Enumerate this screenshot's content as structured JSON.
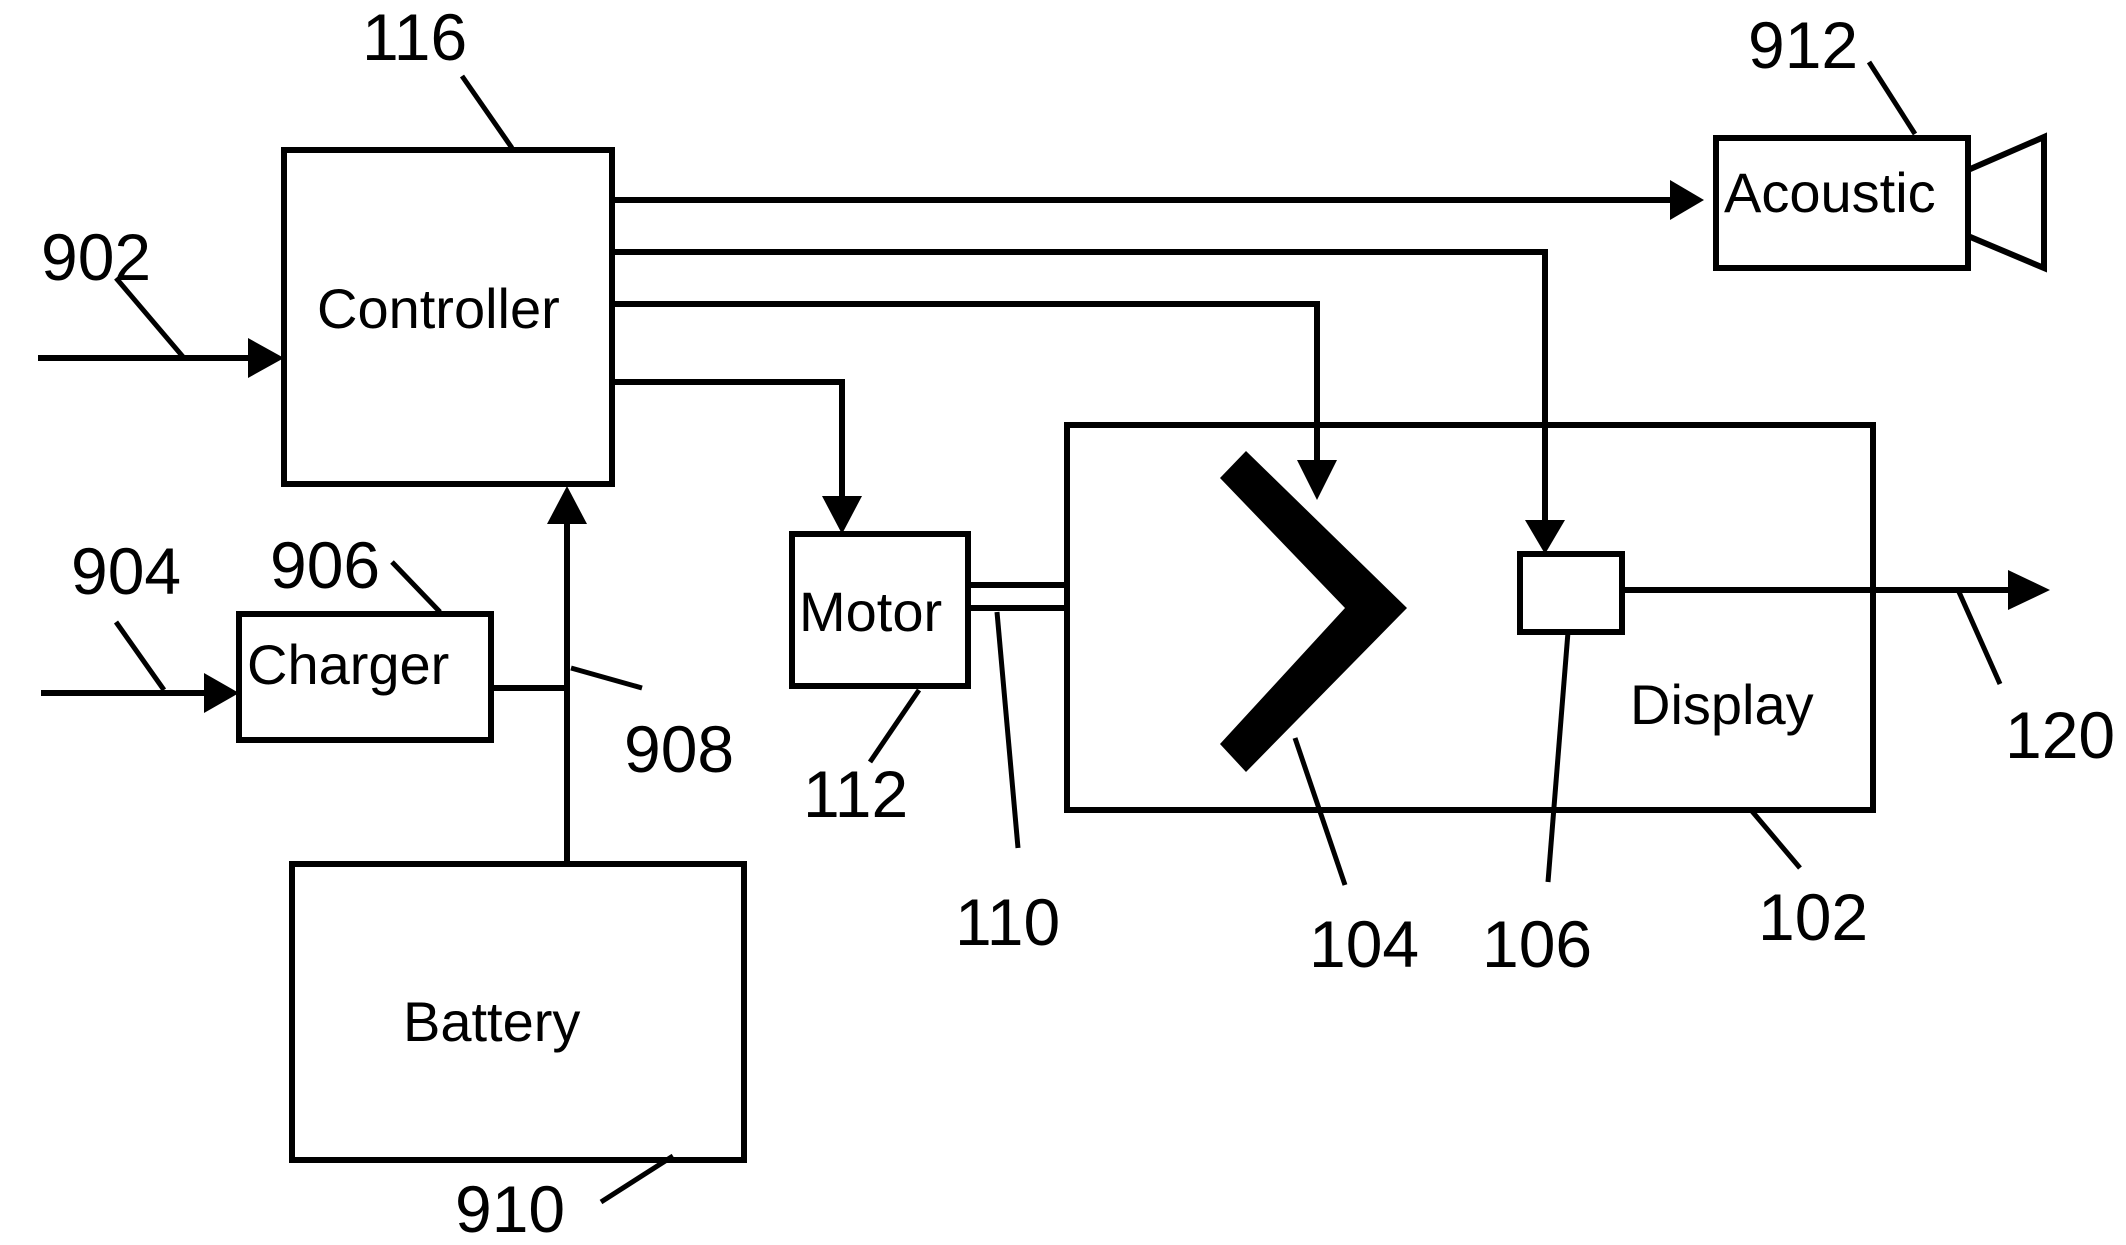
{
  "diagram": {
    "type": "block-diagram",
    "blocks": {
      "controller": {
        "label": "Controller",
        "ref": "116"
      },
      "charger": {
        "label": "Charger",
        "ref": "906"
      },
      "battery": {
        "label": "Battery",
        "ref": "910"
      },
      "motor": {
        "label": "Motor",
        "ref": "112"
      },
      "display": {
        "label": "Display",
        "ref": "102"
      },
      "acoustic": {
        "label": "Acoustic",
        "ref": "912"
      },
      "sensor": {
        "label": "",
        "ref": "106"
      },
      "reflector": {
        "label": "",
        "ref": "104"
      }
    },
    "refs": {
      "input_controller": "902",
      "input_charger": "904",
      "power_line": "908",
      "shaft": "110",
      "output": "120"
    },
    "connections": [
      {
        "from": "input_902",
        "to": "controller"
      },
      {
        "from": "input_904",
        "to": "charger"
      },
      {
        "from": "charger",
        "to": "power_line_908"
      },
      {
        "from": "battery",
        "to": "controller"
      },
      {
        "from": "controller",
        "to": "acoustic"
      },
      {
        "from": "controller",
        "to": "sensor"
      },
      {
        "from": "controller",
        "to": "reflector"
      },
      {
        "from": "controller",
        "to": "motor"
      },
      {
        "from": "motor",
        "to": "display",
        "via": "shaft"
      },
      {
        "from": "sensor",
        "to": "output_120"
      }
    ]
  }
}
